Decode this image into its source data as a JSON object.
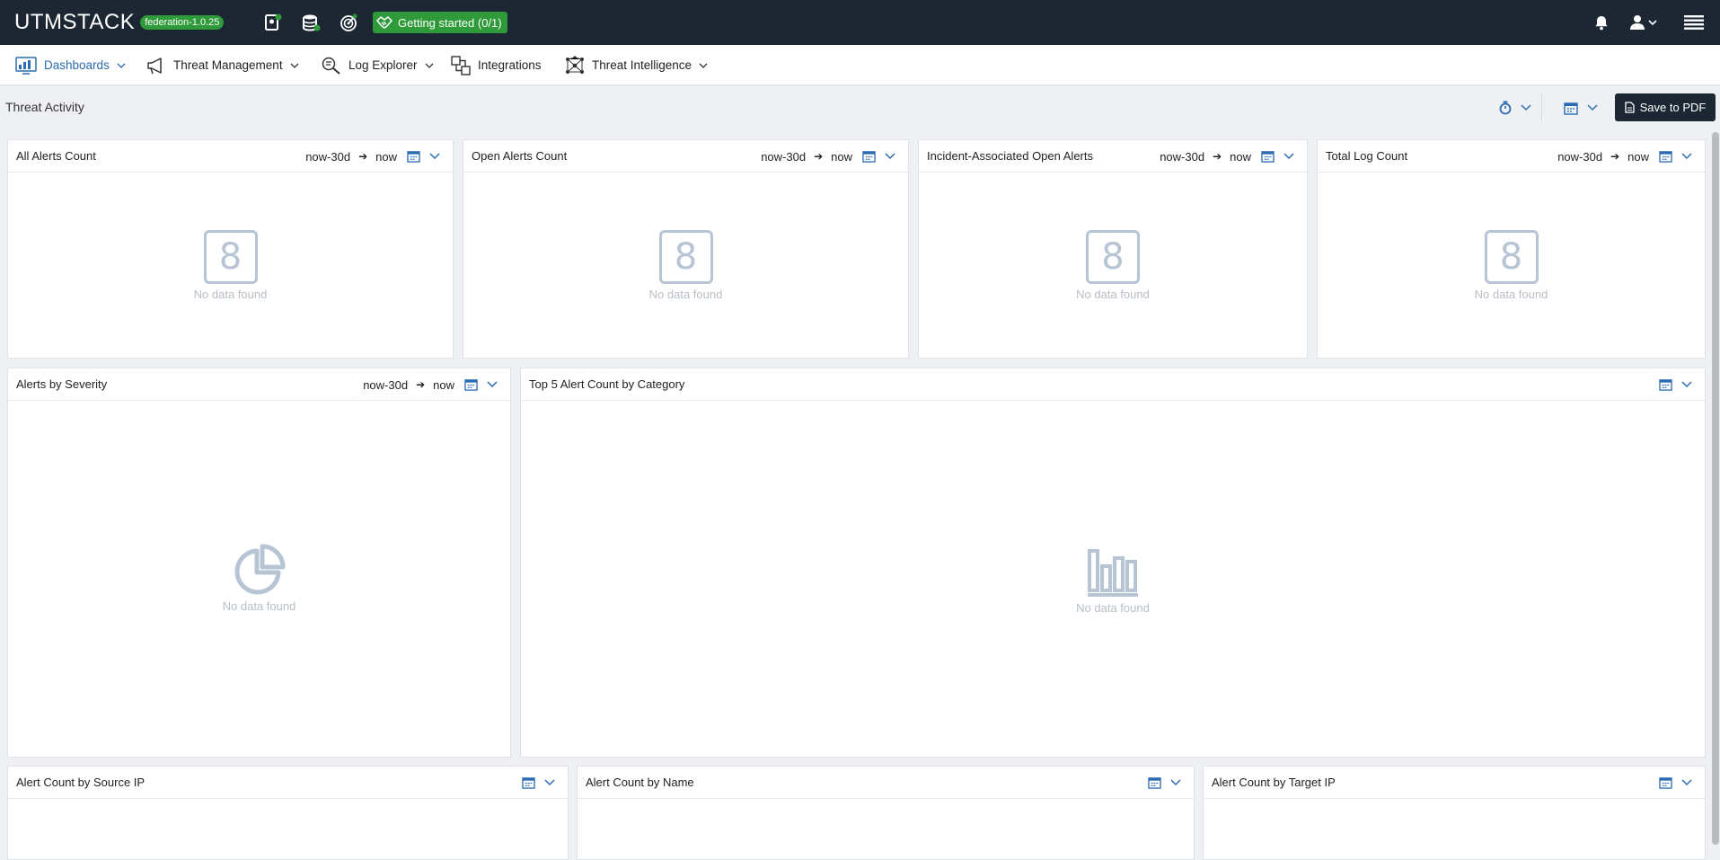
{
  "app": {
    "brand": "UTMSTACK",
    "version": "federation-1.0.25",
    "getting_started": "Getting started (0/1)"
  },
  "nav": {
    "items": [
      {
        "label": "Dashboards",
        "active": true
      },
      {
        "label": "Threat Management"
      },
      {
        "label": "Log Explorer"
      },
      {
        "label": "Integrations"
      },
      {
        "label": "Threat Intelligence"
      }
    ]
  },
  "page": {
    "title": "Threat Activity",
    "save_pdf_label": "Save to PDF"
  },
  "widgets": [
    {
      "title": "All Alerts Count",
      "from": "now-30d",
      "to": "now",
      "empty_text": "No data found",
      "count_glyph": "8"
    },
    {
      "title": "Open Alerts Count",
      "from": "now-30d",
      "to": "now",
      "empty_text": "No data found",
      "count_glyph": "8"
    },
    {
      "title": "Incident-Associated Open Alerts",
      "from": "now-30d",
      "to": "now",
      "empty_text": "No data found",
      "count_glyph": "8"
    },
    {
      "title": "Total Log Count",
      "from": "now-30d",
      "to": "now",
      "empty_text": "No data found",
      "count_glyph": "8"
    },
    {
      "title": "Alerts by Severity",
      "from": "now-30d",
      "to": "now",
      "empty_text": "No data found"
    },
    {
      "title": "Top 5 Alert Count by Category",
      "empty_text": "No data found"
    },
    {
      "title": "Alert Count by Source IP"
    },
    {
      "title": "Alert Count by Name"
    },
    {
      "title": "Alert Count by Target IP"
    }
  ],
  "colors": {
    "topbar": "#1c2733",
    "accent_green": "#2e9a39",
    "active_nav": "#2a6bb1",
    "icon_blue": "#2a6bb1",
    "empty_gray": "#b7c4d3"
  }
}
